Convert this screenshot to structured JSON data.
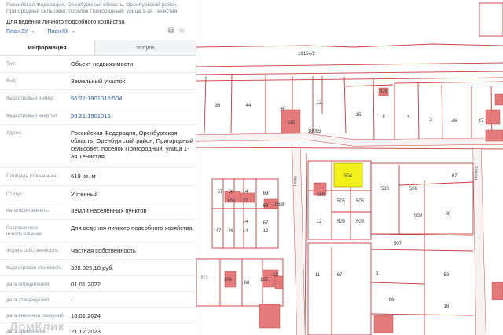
{
  "header": {
    "address_breadcrumb": "Российская Федерация, Оренбургская область, Оренбургский район, Пригородный сельсовет, поселок Пригородный, улица 1-ая Тенистая",
    "title": "Для ведения личного подсобного хозяйства",
    "links": [
      "План ЗУ →",
      "План КК →"
    ]
  },
  "tabs": {
    "info": "Информация",
    "services": "Услуги"
  },
  "properties": [
    {
      "label": "Тип:",
      "value": "Объект недвижимости"
    },
    {
      "label": "Вид:",
      "value": "Земельный участок"
    },
    {
      "label": "Кадастровый номер:",
      "value": "56:21:1901015:504",
      "link": true
    },
    {
      "label": "Кадастровый квартал:",
      "value": "56:21:1901015",
      "link": true
    },
    {
      "label": "Адрес:",
      "value": "Российская Федерация, Оренбургская область, Оренбургский район, Пригородный сельсовет, поселок Пригородный, улица 1-ая Тенистая"
    },
    {
      "label": "Площадь уточненная:",
      "value": "619 кв. м"
    },
    {
      "label": "Статус:",
      "value": "Учтенный"
    },
    {
      "label": "Категория земель:",
      "value": "Земли населённых пунктов"
    },
    {
      "label": "Разрешенное использование:",
      "value": "Для ведения личного подсобного хозяйства"
    },
    {
      "label": "Форма собственности:",
      "value": "Частная собственность"
    },
    {
      "label": "Кадастровая стоимость:",
      "value": "328 825,18 руб."
    },
    {
      "label": "дата определения:",
      "value": "01.01.2022"
    },
    {
      "label": "дата утверждения:",
      "value": "-"
    },
    {
      "label": "дата внесения сведений:",
      "value": "16.01.2024"
    },
    {
      "label": "дата применения:",
      "value": "21.12.2023"
    }
  ],
  "watermark": "ДомКлик",
  "map": {
    "selected_parcel": "504",
    "colors": {
      "boundary": "#c83c3c",
      "building": "#e57a7a",
      "selected": "#f2f21a",
      "road": "#f7f3f3"
    },
    "labels": [
      "19154/2",
      "38",
      "44",
      "40",
      "16б",
      "12",
      "15",
      "8",
      "4",
      "3",
      "46",
      "47",
      "378",
      "18095",
      "67",
      "68",
      "14",
      "69",
      "69",
      "27",
      "106",
      "106/8",
      "47",
      "46",
      "14",
      "12",
      "14",
      "67",
      "504",
      "505",
      "506",
      "510",
      "509",
      "97",
      "16б",
      "505",
      "506",
      "507",
      "509",
      "12",
      "80",
      "112",
      "106",
      "88",
      "105",
      "12",
      "11",
      "67",
      "53",
      "1",
      "96",
      "16",
      "18088",
      "18098/1"
    ]
  }
}
